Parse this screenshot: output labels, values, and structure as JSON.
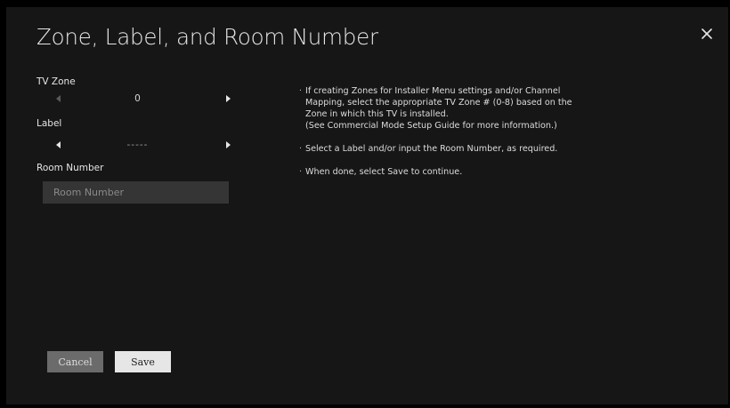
{
  "dialog": {
    "title": "Zone, Label, and Room Number",
    "close_icon": "close-icon"
  },
  "tv_zone": {
    "label": "TV Zone",
    "value": "0",
    "left_arrow_enabled": false,
    "right_arrow_enabled": true
  },
  "label_field": {
    "label": "Label",
    "value": "-----",
    "left_arrow_enabled": true,
    "right_arrow_enabled": true
  },
  "room_number": {
    "label": "Room Number",
    "value": "",
    "placeholder": "Room Number"
  },
  "help": {
    "bullet": "·",
    "items": [
      {
        "lines": [
          "If creating Zones for Installer Menu settings and/or Channel",
          "Mapping, select the appropriate TV Zone # (0-8) based on the",
          "Zone in which this TV is installed.",
          "(See Commercial Mode Setup Guide for more information.)"
        ]
      },
      {
        "lines": [
          "Select a Label and/or input the Room Number, as required."
        ]
      },
      {
        "lines": [
          "When done, select Save to continue."
        ]
      }
    ]
  },
  "buttons": {
    "cancel_label": "Cancel",
    "save_label": "Save"
  },
  "colors": {
    "background": "#000000",
    "panel": "#161616",
    "text": "#e6e6e6",
    "input_bg": "#353535",
    "cancel_bg": "#6b6b6b",
    "save_bg": "#e6e6e6"
  }
}
